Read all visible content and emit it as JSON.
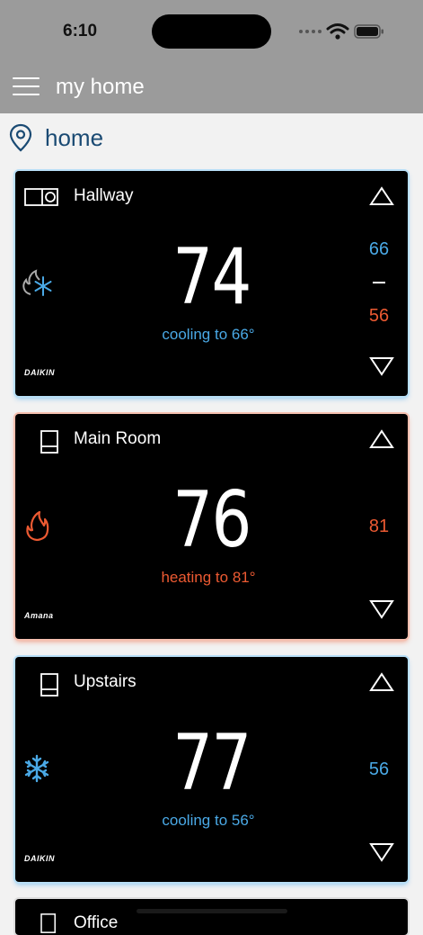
{
  "status_bar": {
    "time": "6:10"
  },
  "app_bar": {
    "title": "my home"
  },
  "location": {
    "name": "home"
  },
  "colors": {
    "cool": "#4aa9e6",
    "heat": "#ec5a32",
    "header": "#9b9b9b",
    "location": "#1a4a73"
  },
  "thermostats": [
    {
      "name": "Hallway",
      "temperature": "74",
      "status": "cooling to 66°",
      "mode": "cool",
      "cool_setpoint": "66",
      "dash": "–",
      "heat_setpoint": "56",
      "brand": "DAIKIN",
      "mode_icon": "flame-snowflake-icon"
    },
    {
      "name": "Main Room",
      "temperature": "76",
      "status": "heating to 81°",
      "mode": "heat",
      "heat_setpoint": "81",
      "brand": "Amana",
      "mode_icon": "flame-icon"
    },
    {
      "name": "Upstairs",
      "temperature": "77",
      "status": "cooling to 56°",
      "mode": "cool",
      "cool_setpoint": "56",
      "brand": "DAIKIN",
      "mode_icon": "snowflake-icon"
    },
    {
      "name": "Office"
    }
  ]
}
